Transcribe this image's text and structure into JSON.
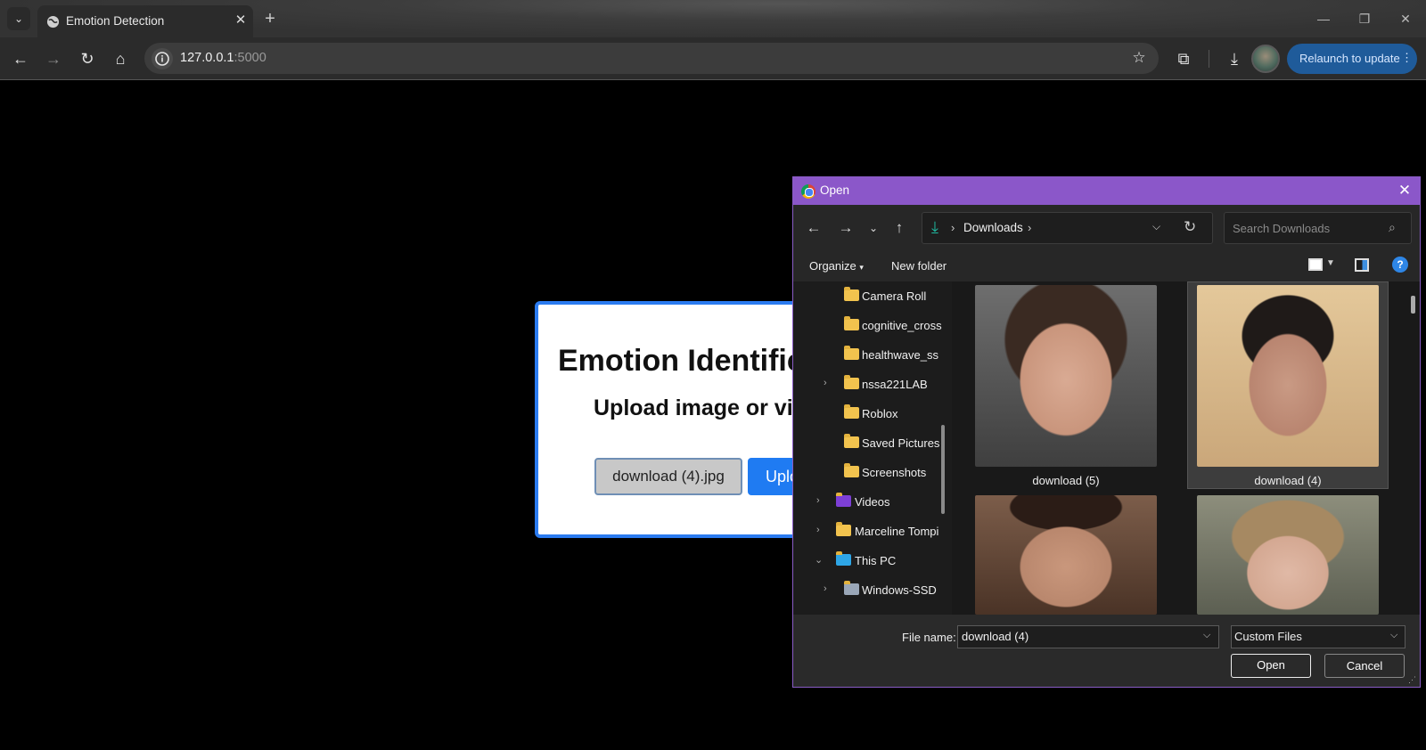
{
  "browser": {
    "tab_title": "Emotion Detection",
    "url_host": "127.0.0.1",
    "url_port": ":5000",
    "relaunch_label": "Relaunch to update",
    "new_tab_glyph": "+",
    "tab_close_glyph": "✕"
  },
  "page": {
    "title": "Emotion Identific",
    "subtitle": "Upload image or vi",
    "file_button": "download (4).jpg",
    "upload_button": "Uplo",
    "accent_color": "#2b7bf0"
  },
  "dialog": {
    "title": "Open",
    "breadcrumb": "Downloads",
    "search_placeholder": "Search Downloads",
    "organize_label": "Organize",
    "new_folder_label": "New folder",
    "tree": [
      {
        "label": "Camera Roll",
        "icon": "folder-icon",
        "expandable": false
      },
      {
        "label": "cognitive_cross",
        "icon": "folder-icon",
        "expandable": false
      },
      {
        "label": "healthwave_ss",
        "icon": "folder-icon",
        "expandable": false
      },
      {
        "label": "nssa221LAB",
        "icon": "folder-icon",
        "expandable": true
      },
      {
        "label": "Roblox",
        "icon": "folder-icon",
        "expandable": false
      },
      {
        "label": "Saved Pictures",
        "icon": "folder-icon",
        "expandable": false
      },
      {
        "label": "Screenshots",
        "icon": "folder-icon",
        "expandable": false
      },
      {
        "label": "Videos",
        "icon": "videos-icon",
        "expandable": true
      },
      {
        "label": "Marceline Tompi",
        "icon": "folder-icon",
        "expandable": true
      },
      {
        "label": "This PC",
        "icon": "pc-icon",
        "expandable": true
      },
      {
        "label": "Windows-SSD",
        "icon": "drive-icon",
        "expandable": true
      }
    ],
    "files": [
      {
        "name": "download (5)",
        "selected": false
      },
      {
        "name": "download (4)",
        "selected": true
      },
      {
        "name": "",
        "selected": false
      },
      {
        "name": "",
        "selected": false
      }
    ],
    "file_name_label": "File name:",
    "file_name_value": "download (4)",
    "file_type_value": "Custom Files",
    "open_button": "Open",
    "cancel_button": "Cancel",
    "titlebar_color": "#8b57c9"
  }
}
